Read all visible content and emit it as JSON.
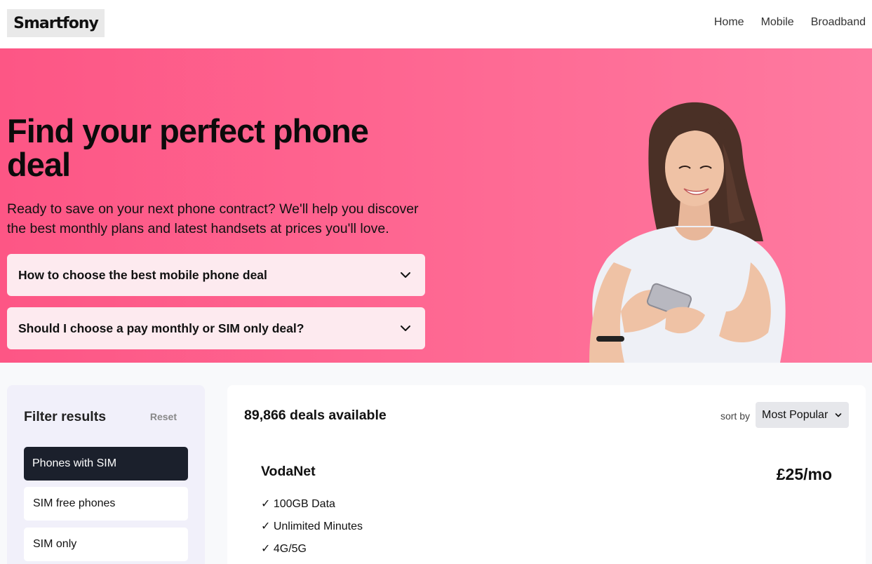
{
  "header": {
    "logo": "Smartfony",
    "nav": [
      "Home",
      "Mobile",
      "Broadband"
    ]
  },
  "hero": {
    "title": "Find your perfect phone deal",
    "subtitle": "Ready to save on your next phone contract? We'll help you discover the best monthly plans and latest handsets at prices you'll love.",
    "faqs": [
      "How to choose the best mobile phone deal",
      "Should I choose a pay monthly or SIM only deal?"
    ]
  },
  "filters": {
    "title": "Filter results",
    "reset": "Reset",
    "options": [
      "Phones with SIM",
      "SIM free phones",
      "SIM only"
    ],
    "active_index": 0
  },
  "results": {
    "count": "89,866 deals available",
    "sort_label": "sort by",
    "sort_value": "Most Popular",
    "deal": {
      "provider": "VodaNet",
      "price": "£25/mo",
      "features": [
        "✓ 100GB Data",
        "✓ Unlimited Minutes",
        "✓ 4G/5G"
      ]
    }
  },
  "colors": {
    "hero_start": "#fd5685",
    "hero_end": "#fe7aa0",
    "active_filter": "#1b202c"
  }
}
